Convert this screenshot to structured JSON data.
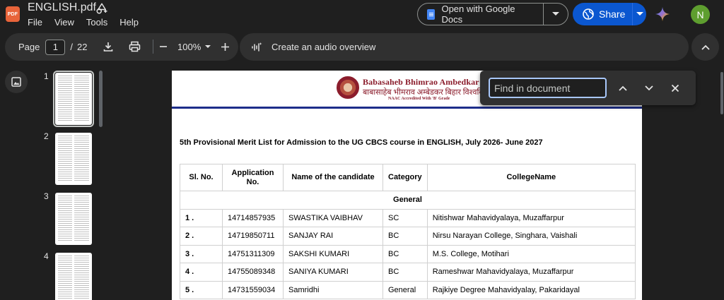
{
  "app": {
    "file_name": "ENGLISH.pdf",
    "logo_text": "PDF",
    "menu": [
      "File",
      "View",
      "Tools",
      "Help"
    ],
    "open_with_label": "Open with Google Docs",
    "share_label": "Share",
    "avatar_initial": "N"
  },
  "toolbar": {
    "page_label": "Page",
    "current_page": "1",
    "separator": "/",
    "total_pages": "22",
    "zoom": "100%",
    "audio_label": "Create an audio overview"
  },
  "sidebar": {
    "thumbnails": [
      {
        "number": "1",
        "selected": true
      },
      {
        "number": "2",
        "selected": false
      },
      {
        "number": "3",
        "selected": false
      },
      {
        "number": "4",
        "selected": false
      }
    ]
  },
  "find": {
    "placeholder": "Find in document",
    "value": ""
  },
  "document": {
    "university_name": "Babasaheb Bhimrao Ambedkar Bihar University",
    "university_name_hindi": "बाबासाहेब भीमराव अम्बेडकर बिहार विश्वविद्यालय",
    "naac_text": "NAAC Accredited With 'B' Grade",
    "title": "5th Provisional Merit List for Admission to the UG CBCS course in ENGLISH, July 2026- June 2027",
    "table": {
      "headers": [
        "Sl. No.",
        "Application No.",
        "Name of the candidate",
        "Category",
        "CollegeName"
      ],
      "group": "General",
      "rows": [
        [
          "1 .",
          "14714857935",
          "SWASTIKA VAIBHAV",
          "SC",
          "Nitishwar Mahavidyalaya, Muzaffarpur"
        ],
        [
          "2 .",
          "14719850711",
          "SANJAY RAI",
          "BC",
          "Nirsu Narayan College, Singhara, Vaishali"
        ],
        [
          "3 .",
          "14751311309",
          "SAKSHI KUMARI",
          "BC",
          "M.S. College, Motihari"
        ],
        [
          "4 .",
          "14755089348",
          "SANIYA KUMARI",
          "BC",
          "Rameshwar Mahavidyalaya, Muzaffarpur"
        ],
        [
          "5 .",
          "14731559034",
          "Samridhi",
          "General",
          "Rajkiye Degree Mahavidyalay, Pakaridayal"
        ]
      ]
    }
  },
  "colors": {
    "background": "#1f1f1f",
    "panel": "#303030",
    "share_button": "#0b57d0",
    "find_focus": "#a8c7fa",
    "avatar": "#5e9e2f",
    "university_maroon": "#8b1d2c",
    "header_rule": "#1d2e8a"
  },
  "icons": [
    "add-shortcut-icon",
    "docs-icon",
    "chevron-down-icon",
    "globe-icon",
    "gemini-icon",
    "download-icon",
    "print-icon",
    "zoom-out-icon",
    "zoom-in-icon",
    "audio-wave-icon",
    "chevron-up-icon",
    "image-icon",
    "close-icon"
  ]
}
